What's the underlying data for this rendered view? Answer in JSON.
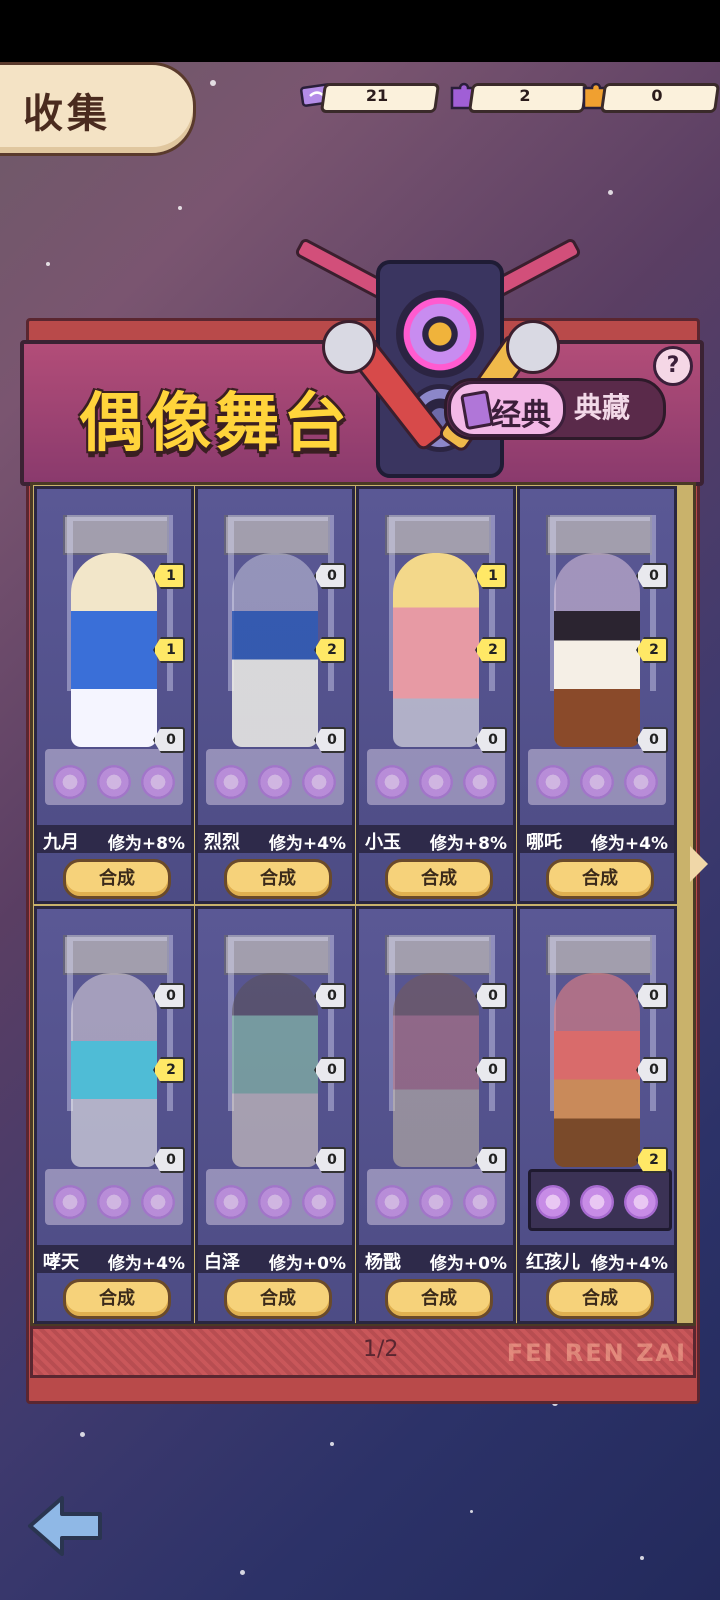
{
  "header": {
    "title": "收集"
  },
  "resources": [
    {
      "icon": "ticket-icon",
      "value": "21"
    },
    {
      "icon": "purple-puzzle-icon",
      "value": "2"
    },
    {
      "icon": "orange-puzzle-icon",
      "value": "0"
    }
  ],
  "banner": {
    "title": "偶像舞台",
    "tab_active": "经典",
    "tab_inactive": "典藏",
    "help": "?"
  },
  "cards": [
    {
      "name": "九月",
      "bonus": "修为+8%",
      "badges": [
        "1",
        "1",
        "0"
      ],
      "button": "合成"
    },
    {
      "name": "烈烈",
      "bonus": "修为+4%",
      "badges": [
        "0",
        "2",
        "0"
      ],
      "button": "合成"
    },
    {
      "name": "小玉",
      "bonus": "修为+8%",
      "badges": [
        "1",
        "2",
        "0"
      ],
      "button": "合成"
    },
    {
      "name": "哪吒",
      "bonus": "修为+4%",
      "badges": [
        "0",
        "2",
        "0"
      ],
      "button": "合成"
    },
    {
      "name": "哮天",
      "bonus": "修为+4%",
      "badges": [
        "0",
        "2",
        "0"
      ],
      "button": "合成"
    },
    {
      "name": "白泽",
      "bonus": "修为+0%",
      "badges": [
        "0",
        "0",
        "0"
      ],
      "button": "合成"
    },
    {
      "name": "杨戬",
      "bonus": "修为+0%",
      "badges": [
        "0",
        "0",
        "0"
      ],
      "button": "合成"
    },
    {
      "name": "红孩儿",
      "bonus": "修为+4%",
      "badges": [
        "0",
        "0",
        "2"
      ],
      "button": "合成"
    }
  ],
  "footer": {
    "page": "1/2",
    "watermark": "FEI REN ZAI"
  },
  "colors": {
    "accent": "#ffd43b",
    "badge_on": "#ffe866",
    "button": "#f6d27a"
  }
}
